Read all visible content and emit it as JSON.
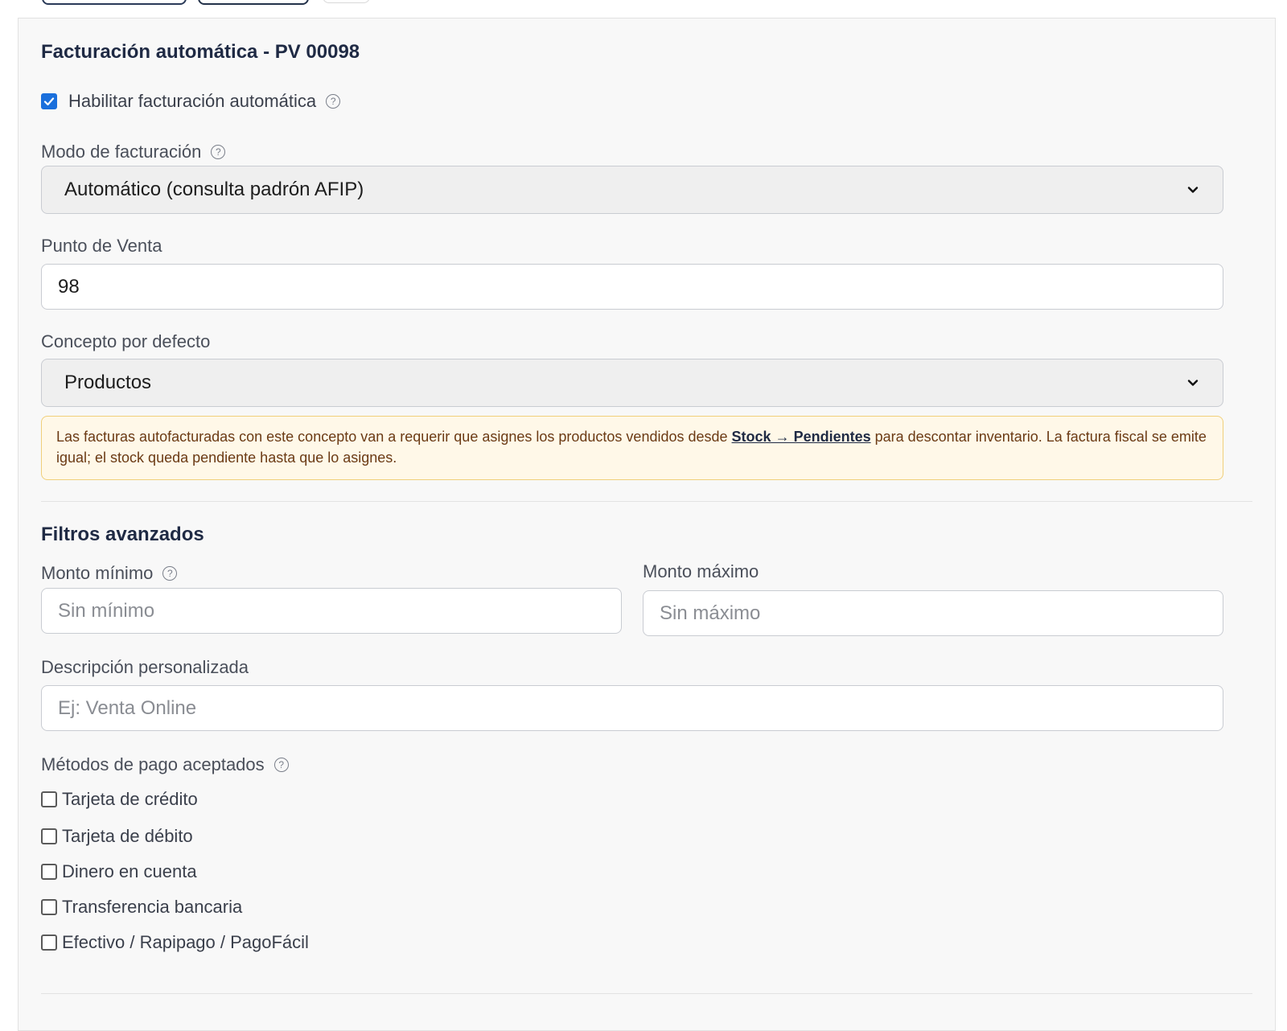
{
  "section": {
    "title": "Facturación automática - PV 00098",
    "enable_label": "Habilitar facturación automática",
    "enable_checked": true
  },
  "modo": {
    "label": "Modo de facturación",
    "value": "Automático (consulta padrón AFIP)"
  },
  "punto_venta": {
    "label": "Punto de Venta",
    "value": "98"
  },
  "concepto": {
    "label": "Concepto por defecto",
    "value": "Productos"
  },
  "notice": {
    "text_before": "Las facturas autofacturadas con este concepto van a requerir que asignes los productos vendidos desde",
    "link": "Stock → Pendientes",
    "text_after": "para descontar inventario. La factura fiscal se emite igual; el stock queda pendiente hasta que lo asignes."
  },
  "filtros": {
    "title": "Filtros avanzados",
    "monto_min_label": "Monto mínimo",
    "monto_min_placeholder": "Sin mínimo",
    "monto_max_label": "Monto máximo",
    "monto_max_placeholder": "Sin máximo",
    "desc_label": "Descripción personalizada",
    "desc_placeholder": "Ej: Venta Online"
  },
  "metodos": {
    "label": "Métodos de pago aceptados",
    "items": [
      {
        "label": "Tarjeta de crédito",
        "checked": false
      },
      {
        "label": "Tarjeta de débito",
        "checked": false
      },
      {
        "label": "Dinero en cuenta",
        "checked": false
      },
      {
        "label": "Transferencia bancaria",
        "checked": false
      },
      {
        "label": "Efectivo / Rapipago / PagoFácil",
        "checked": false
      }
    ]
  },
  "icons": {
    "help": "help-circle-icon",
    "check": "checkmark-icon",
    "chevron": "chevron-down-icon"
  },
  "colors": {
    "accent": "#1a6fdc",
    "title": "#1f2a44",
    "notice_bg": "#fff8e8",
    "notice_border": "#f0cf7a"
  }
}
